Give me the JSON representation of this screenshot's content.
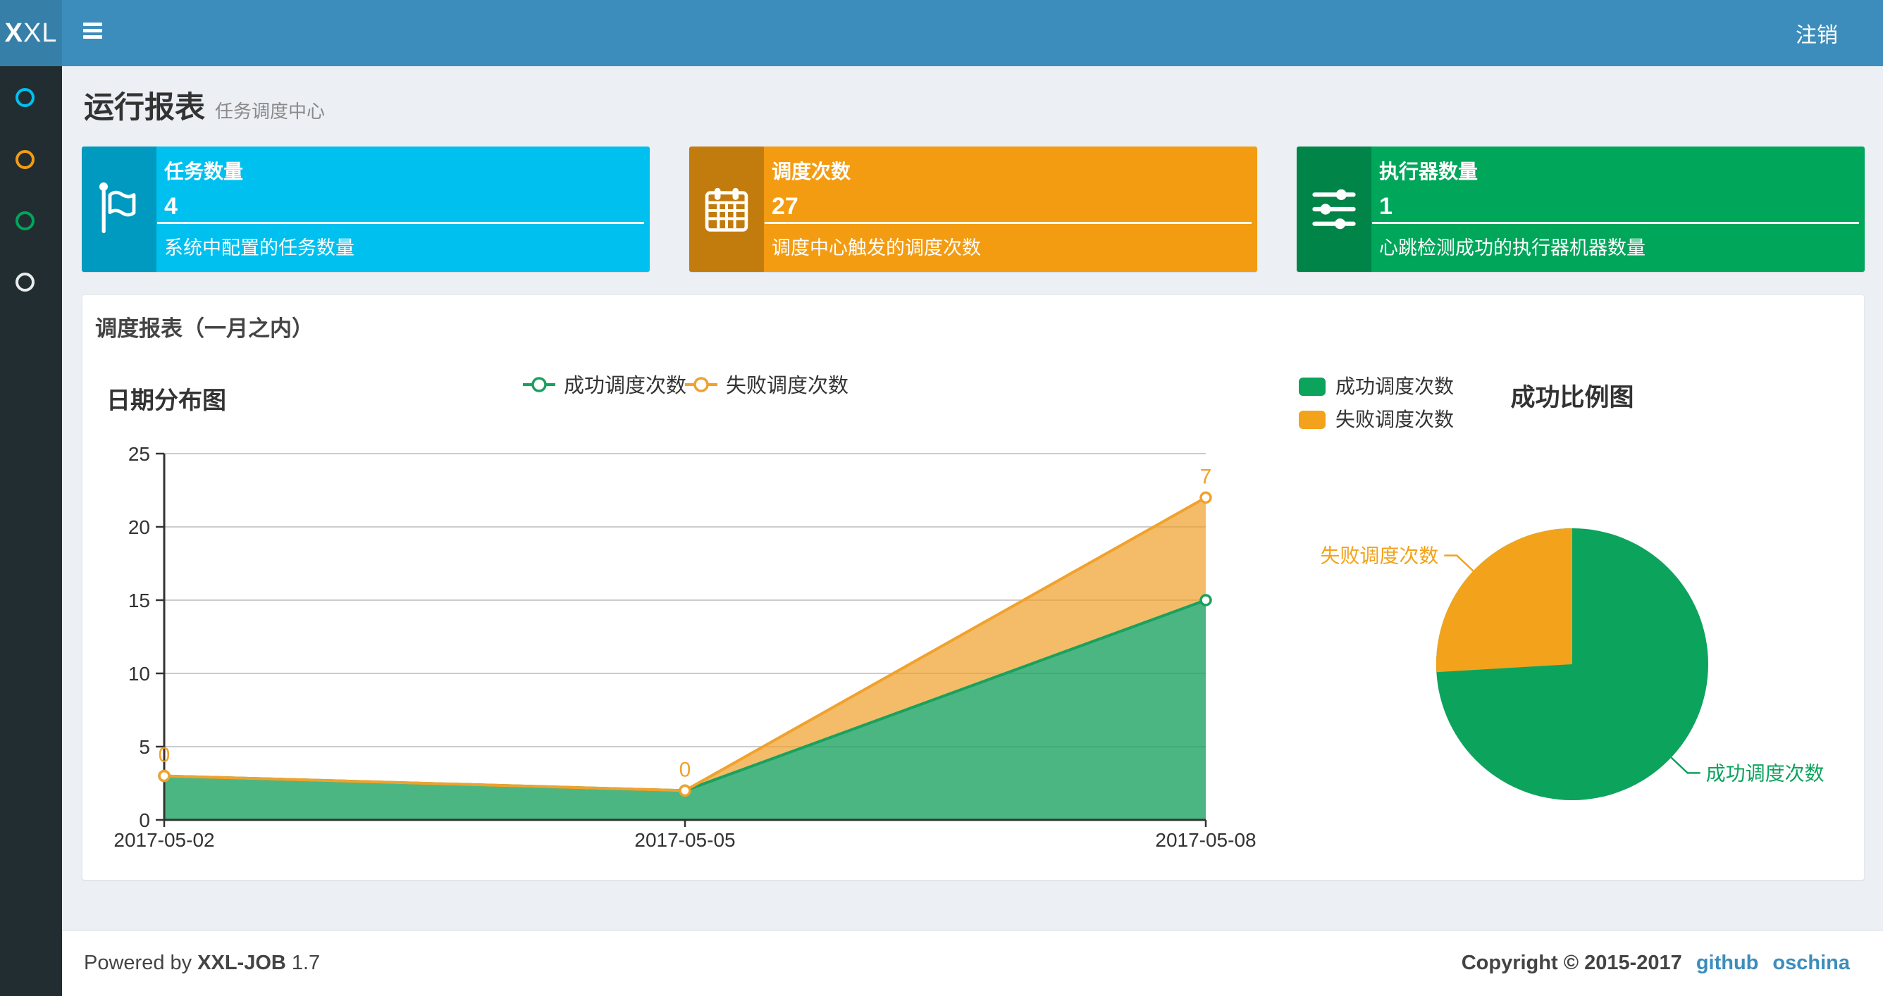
{
  "navbar": {
    "logo_bold": "X",
    "logo_light": "XL",
    "logout_label": "注销"
  },
  "sidebar": {
    "items": [
      {
        "name": "menu-report",
        "icon": "circle-outline-icon",
        "color": "#00c0ef"
      },
      {
        "name": "menu-jobs",
        "icon": "circle-outline-icon",
        "color": "#f39c12"
      },
      {
        "name": "menu-executors",
        "icon": "circle-outline-icon",
        "color": "#00a65a"
      },
      {
        "name": "menu-help",
        "icon": "circle-outline-icon",
        "color": "#e8eced"
      }
    ]
  },
  "page_header": {
    "title": "运行报表",
    "subtitle": "任务调度中心"
  },
  "info_boxes": [
    {
      "title": "任务数量",
      "value": "4",
      "desc": "系统中配置的任务数量",
      "bg": "#00c0ef",
      "icon": "flag-icon"
    },
    {
      "title": "调度次数",
      "value": "27",
      "desc": "调度中心触发的调度次数",
      "bg": "#f39c12",
      "icon": "calendar-icon"
    },
    {
      "title": "执行器数量",
      "value": "1",
      "desc": "心跳检测成功的执行器机器数量",
      "bg": "#00a65a",
      "icon": "sliders-icon"
    }
  ],
  "panel": {
    "title": "调度报表（一月之内）"
  },
  "chart_data": [
    {
      "type": "area",
      "title": "日期分布图",
      "x": [
        "2017-05-02",
        "2017-05-05",
        "2017-05-08"
      ],
      "series": [
        {
          "name": "成功调度次数",
          "values": [
            3,
            2,
            15
          ],
          "color": "#19a15f",
          "fill": "rgba(25,161,95,0.78)",
          "show_labels": false
        },
        {
          "name": "失败调度次数",
          "values": [
            0,
            0,
            7
          ],
          "color": "#f0a22d",
          "fill": "rgba(240,160,40,0.7)",
          "show_labels": true
        }
      ],
      "stacked": true,
      "ylim": [
        0,
        25
      ],
      "yticks": [
        0,
        5,
        10,
        15,
        20,
        25
      ],
      "grid": true,
      "legend_position": "top-center",
      "xlabel": "",
      "ylabel": ""
    },
    {
      "type": "pie",
      "title": "成功比例图",
      "slices": [
        {
          "name": "成功调度次数",
          "value": 20,
          "color": "#0ca35c"
        },
        {
          "name": "失败调度次数",
          "value": 7,
          "color": "#f2a31b"
        }
      ],
      "legend_position": "top-left",
      "start_angle_deg": 90
    }
  ],
  "footer": {
    "powered_prefix": "Powered by",
    "product": "XXL-JOB",
    "version": "1.7",
    "copyright": "Copyright © 2015-2017",
    "links": [
      "github",
      "oschina"
    ]
  }
}
